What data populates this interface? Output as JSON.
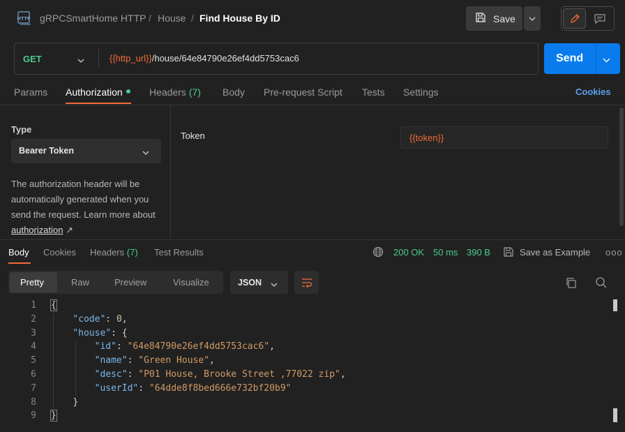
{
  "header": {
    "icon": "http-request-icon",
    "breadcrumb": [
      "gRPCSmartHome HTTP",
      "House",
      "Find House By ID"
    ],
    "save_label": "Save"
  },
  "request": {
    "method": "GET",
    "url_variable": "{{http_url}}",
    "url_path": "/house/64e84790e26ef4dd5753cac6",
    "send_label": "Send"
  },
  "request_tabs": {
    "params": "Params",
    "authorization": "Authorization",
    "headers": "Headers",
    "headers_count": "(7)",
    "body": "Body",
    "prerequest": "Pre-request Script",
    "tests": "Tests",
    "settings": "Settings",
    "cookies": "Cookies",
    "active": "Authorization"
  },
  "auth": {
    "type_label": "Type",
    "type_value": "Bearer Token",
    "help_text": "The authorization header will be automatically generated when you send the request. Learn more about ",
    "help_link": "authorization",
    "help_link_arrow": "↗",
    "token_label": "Token",
    "token_value": "{{token}}"
  },
  "response_tabs": {
    "body": "Body",
    "cookies": "Cookies",
    "headers": "Headers",
    "headers_count": "(7)",
    "test_results": "Test Results",
    "active": "Body"
  },
  "response_status": {
    "status": "200 OK",
    "time": "50 ms",
    "size": "390 B",
    "save_example": "Save as Example",
    "more": "ooo"
  },
  "response_toolbar": {
    "formats": [
      "Pretty",
      "Raw",
      "Preview",
      "Visualize"
    ],
    "active_format": "Pretty",
    "language": "JSON"
  },
  "code": {
    "line_numbers": [
      "1",
      "2",
      "3",
      "4",
      "5",
      "6",
      "7",
      "8",
      "9"
    ],
    "open_brace": "{",
    "code_key": "\"code\"",
    "code_value": "0",
    "house_key": "\"house\"",
    "id_key": "\"id\"",
    "id_value": "\"64e84790e26ef4dd5753cac6\"",
    "name_key": "\"name\"",
    "name_value": "\"Green House\"",
    "desc_key": "\"desc\"",
    "desc_value": "\"P01 House, Brooke Street ,77022 zip\"",
    "userid_key": "\"userId\"",
    "userid_value": "\"64dde8f8bed666e732bf20b9\"",
    "inner_close": "}",
    "close_brace": "}"
  },
  "colors": {
    "background": "#212121",
    "accent_orange": "#f26b3a",
    "send_blue": "#097bed",
    "status_green": "#49cc90",
    "link_blue": "#5aa0ea"
  }
}
